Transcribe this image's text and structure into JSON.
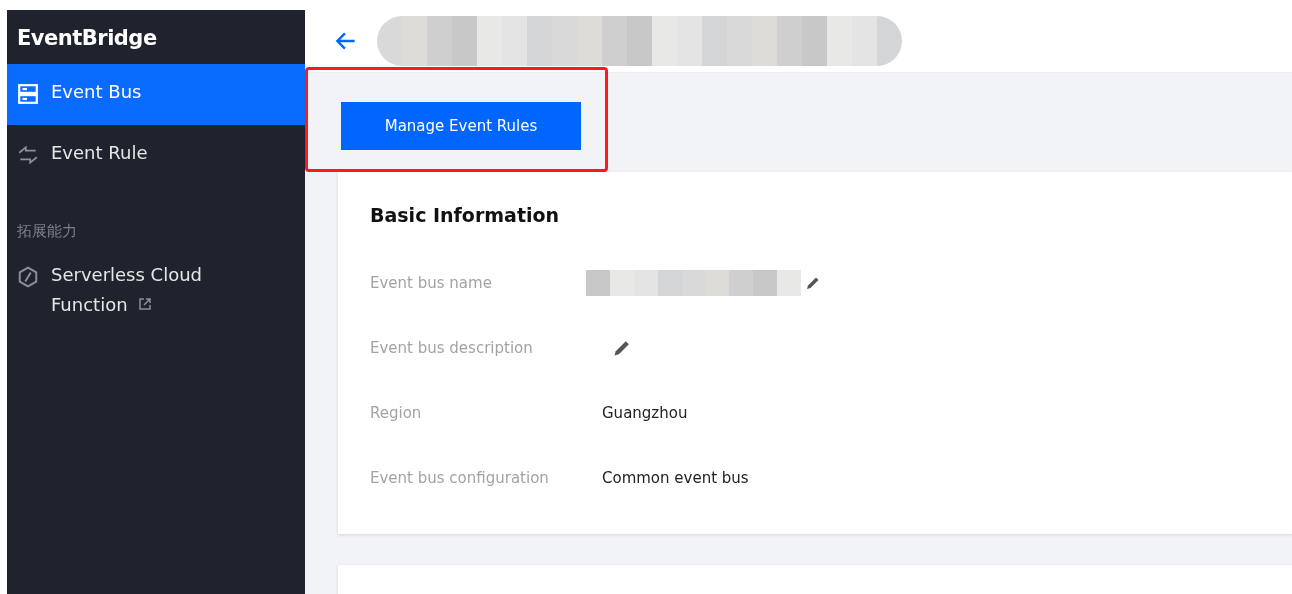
{
  "sidebar": {
    "title": "EventBridge",
    "items": [
      {
        "kind": "nav",
        "label": "Event Bus",
        "selected": true
      },
      {
        "kind": "nav",
        "label": "Event Rule",
        "selected": false
      },
      {
        "kind": "section",
        "label": "拓展能力"
      },
      {
        "kind": "nav",
        "label": "Serverless Cloud Function",
        "selected": false,
        "external": true
      }
    ]
  },
  "toolbar": {
    "button": "Manage Event Rules",
    "highlighted": true
  },
  "card": {
    "title": "Basic Information",
    "fields": [
      {
        "label": "Event bus name",
        "kind": "redacted",
        "editable": true
      },
      {
        "label": "Event bus description",
        "kind": "empty",
        "editable": true
      },
      {
        "label": "Region",
        "kind": "text",
        "value": "Guangzhou",
        "editable": false
      },
      {
        "label": "Event bus configuration",
        "kind": "text",
        "value": "Common event bus",
        "editable": false
      }
    ]
  }
}
